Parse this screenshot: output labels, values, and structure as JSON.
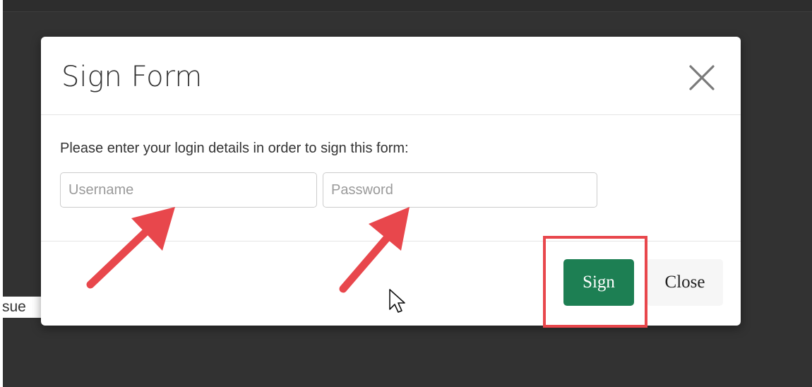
{
  "background": {
    "partial_text": "sue"
  },
  "modal": {
    "title": "Sign Form",
    "close_icon": "close-icon",
    "instructions": "Please enter your login details in order to sign this form:",
    "username": {
      "placeholder": "Username",
      "value": ""
    },
    "password": {
      "placeholder": "Password",
      "value": ""
    },
    "buttons": {
      "sign": "Sign",
      "close": "Close"
    }
  },
  "annotations": {
    "arrow_color": "#e8474c",
    "highlight_color": "#e8474c",
    "arrows": [
      "arrow-icon",
      "arrow-icon"
    ],
    "cursor_icon": "mouse-pointer-icon"
  },
  "colors": {
    "backdrop": "#323232",
    "sign_button": "#1d7f53",
    "close_button": "#f6f6f6"
  }
}
